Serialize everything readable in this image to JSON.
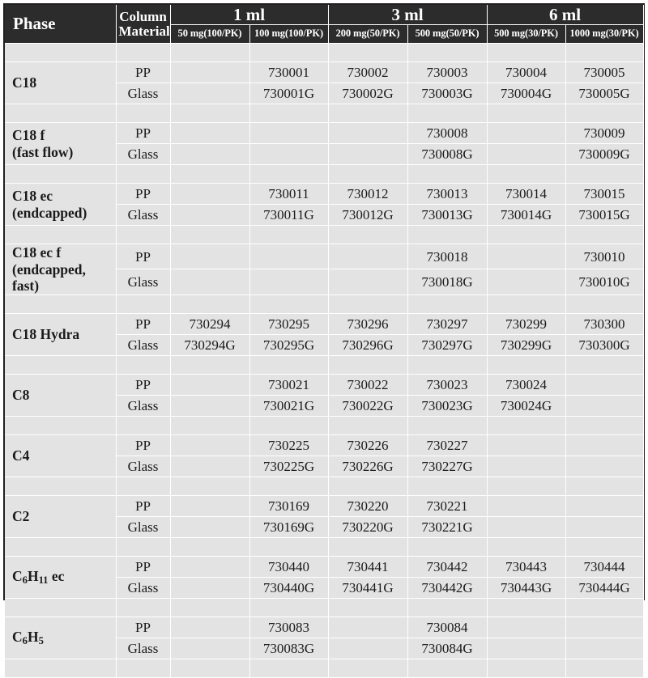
{
  "table": {
    "header": {
      "phase_label": "Phase",
      "material_label_line1": "Column",
      "material_label_line2": "Material",
      "volume_groups": [
        {
          "label": "1 ml",
          "columns": [
            "50 mg(100/PK)",
            "100 mg(100/PK)"
          ]
        },
        {
          "label": "3 ml",
          "columns": [
            "200 mg(50/PK)",
            "500 mg(50/PK)"
          ]
        },
        {
          "label": "6 ml",
          "columns": [
            "500 mg(30/PK)",
            "1000 mg(30/PK)"
          ]
        }
      ]
    },
    "material_rows": [
      "PP",
      "Glass"
    ],
    "groups": [
      {
        "phase_line1": "C18",
        "phase_line2": "",
        "rows": [
          {
            "material": "PP",
            "codes": [
              "",
              "730001",
              "730002",
              "730003",
              "730004",
              "730005"
            ]
          },
          {
            "material": "Glass",
            "codes": [
              "",
              "730001G",
              "730002G",
              "730003G",
              "730004G",
              "730005G"
            ]
          }
        ]
      },
      {
        "phase_line1": "C18 f",
        "phase_line2": "(fast flow)",
        "rows": [
          {
            "material": "PP",
            "codes": [
              "",
              "",
              "",
              "730008",
              "",
              "730009"
            ]
          },
          {
            "material": "Glass",
            "codes": [
              "",
              "",
              "",
              "730008G",
              "",
              "730009G"
            ]
          }
        ]
      },
      {
        "phase_line1": "C18 ec",
        "phase_line2": "(endcapped)",
        "rows": [
          {
            "material": "PP",
            "codes": [
              "",
              "730011",
              "730012",
              "730013",
              "730014",
              "730015"
            ]
          },
          {
            "material": "Glass",
            "codes": [
              "",
              "730011G",
              "730012G",
              "730013G",
              "730014G",
              "730015G"
            ]
          }
        ]
      },
      {
        "phase_line1": "C18 ec f",
        "phase_line2": "(endcapped, fast)",
        "rows": [
          {
            "material": "PP",
            "codes": [
              "",
              "",
              "",
              "730018",
              "",
              "730010"
            ]
          },
          {
            "material": "Glass",
            "codes": [
              "",
              "",
              "",
              "730018G",
              "",
              "730010G"
            ]
          }
        ]
      },
      {
        "phase_line1": "C18 Hydra",
        "phase_line2": "",
        "rows": [
          {
            "material": "PP",
            "codes": [
              "730294",
              "730295",
              "730296",
              "730297",
              "730299",
              "730300"
            ]
          },
          {
            "material": "Glass",
            "codes": [
              "730294G",
              "730295G",
              "730296G",
              "730297G",
              "730299G",
              "730300G"
            ]
          }
        ]
      },
      {
        "phase_line1": "C8",
        "phase_line2": "",
        "rows": [
          {
            "material": "PP",
            "codes": [
              "",
              "730021",
              "730022",
              "730023",
              "730024",
              ""
            ]
          },
          {
            "material": "Glass",
            "codes": [
              "",
              "730021G",
              "730022G",
              "730023G",
              "730024G",
              ""
            ]
          }
        ]
      },
      {
        "phase_line1": "C4",
        "phase_line2": "",
        "rows": [
          {
            "material": "PP",
            "codes": [
              "",
              "730225",
              "730226",
              "730227",
              "",
              ""
            ]
          },
          {
            "material": "Glass",
            "codes": [
              "",
              "730225G",
              "730226G",
              "730227G",
              "",
              ""
            ]
          }
        ]
      },
      {
        "phase_line1": "C2",
        "phase_line2": "",
        "rows": [
          {
            "material": "PP",
            "codes": [
              "",
              "730169",
              "730220",
              "730221",
              "",
              ""
            ]
          },
          {
            "material": "Glass",
            "codes": [
              "",
              "730169G",
              "730220G",
              "730221G",
              "",
              ""
            ]
          }
        ]
      },
      {
        "phase_line1": "C6H11 ec",
        "phase_formula": [
          {
            "t": "C"
          },
          {
            "t": "6",
            "sub": true
          },
          {
            "t": "H"
          },
          {
            "t": "11",
            "sub": true
          },
          {
            "t": " ec"
          }
        ],
        "phase_line2": "",
        "rows": [
          {
            "material": "PP",
            "codes": [
              "",
              "730440",
              "730441",
              "730442",
              "730443",
              "730444"
            ]
          },
          {
            "material": "Glass",
            "codes": [
              "",
              "730440G",
              "730441G",
              "730442G",
              "730443G",
              "730444G"
            ]
          }
        ]
      },
      {
        "phase_line1": "C6H5",
        "phase_formula": [
          {
            "t": "C"
          },
          {
            "t": "6",
            "sub": true
          },
          {
            "t": "H"
          },
          {
            "t": "5",
            "sub": true
          }
        ],
        "phase_line2": "",
        "rows": [
          {
            "material": "PP",
            "codes": [
              "",
              "730083",
              "",
              "730084",
              "",
              ""
            ]
          },
          {
            "material": "Glass",
            "codes": [
              "",
              "730083G",
              "",
              "730084G",
              "",
              ""
            ]
          }
        ]
      }
    ]
  },
  "colors": {
    "header_bg": "#2c2c2c",
    "header_text": "#ffffff",
    "body_bg": "#e3e3e3",
    "grid_line": "#ffffff",
    "frame": "#231f20",
    "body_text": "#1a1a1a"
  }
}
